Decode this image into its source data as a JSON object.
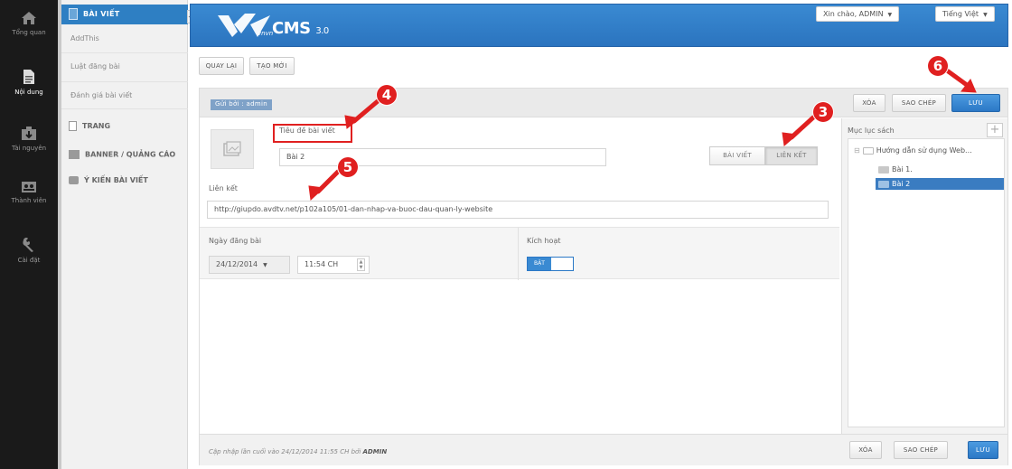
{
  "nav": {
    "items": [
      {
        "label": "Tổng quan",
        "icon": "home-icon"
      },
      {
        "label": "Nội dung",
        "icon": "document-icon"
      },
      {
        "label": "Tài nguyên",
        "icon": "download-icon"
      },
      {
        "label": "Thành viên",
        "icon": "users-icon"
      },
      {
        "label": "Cài đặt",
        "icon": "wrench-icon"
      }
    ]
  },
  "subnav": {
    "header": "BÀI VIẾT",
    "subitems": [
      "AddThis",
      "Luật đăng bài",
      "Đánh giá bài viết"
    ],
    "sections": [
      "TRANG",
      "BANNER / QUẢNG CÁO",
      "Ý KIẾN BÀI VIẾT"
    ],
    "collapse": "<<"
  },
  "header": {
    "logo_small": "vnvn",
    "logo_text": "CMS",
    "logo_version": "3.0",
    "greeting": "Xin chào, ADMIN",
    "language": "Tiếng Việt"
  },
  "actions": {
    "back": "QUAY LẠI",
    "new": "TẠO MỚI"
  },
  "toolbar": {
    "author": "Gửi bởi : admin",
    "delete": "XÓA",
    "copy": "SAO CHÉP",
    "save": "LƯU"
  },
  "form": {
    "title_label": "Tiêu đề bài viết",
    "title_value": "Bài 2",
    "tab_article": "BÀI VIẾT",
    "tab_link": "LIÊN KẾT",
    "link_label": "Liên kết",
    "link_value": "http://giupdo.avdtv.net/p102a105/01-dan-nhap-va-buoc-dau-quan-ly-website",
    "date_label": "Ngày đăng bài",
    "date_value": "24/12/2014",
    "time_value": "11:54 CH",
    "active_label": "Kích hoạt",
    "active_value": "BẬT"
  },
  "catalog": {
    "title": "Mục lục sách",
    "root": "Hướng dẫn sử dụng Web...",
    "children": [
      "Bài 1.",
      "Bài 2"
    ]
  },
  "footer": {
    "text": "Cập nhập lần cuối vào 24/12/2014 11:55 CH bởi",
    "user": "ADMIN",
    "delete": "XÓA",
    "copy": "SAO CHÉP",
    "save": "LƯU"
  },
  "annotations": [
    "3",
    "4",
    "5",
    "6"
  ],
  "colors": {
    "accent": "#2e7fc3",
    "annotation": "#e02020",
    "sidebar": "#1a1a1a"
  }
}
